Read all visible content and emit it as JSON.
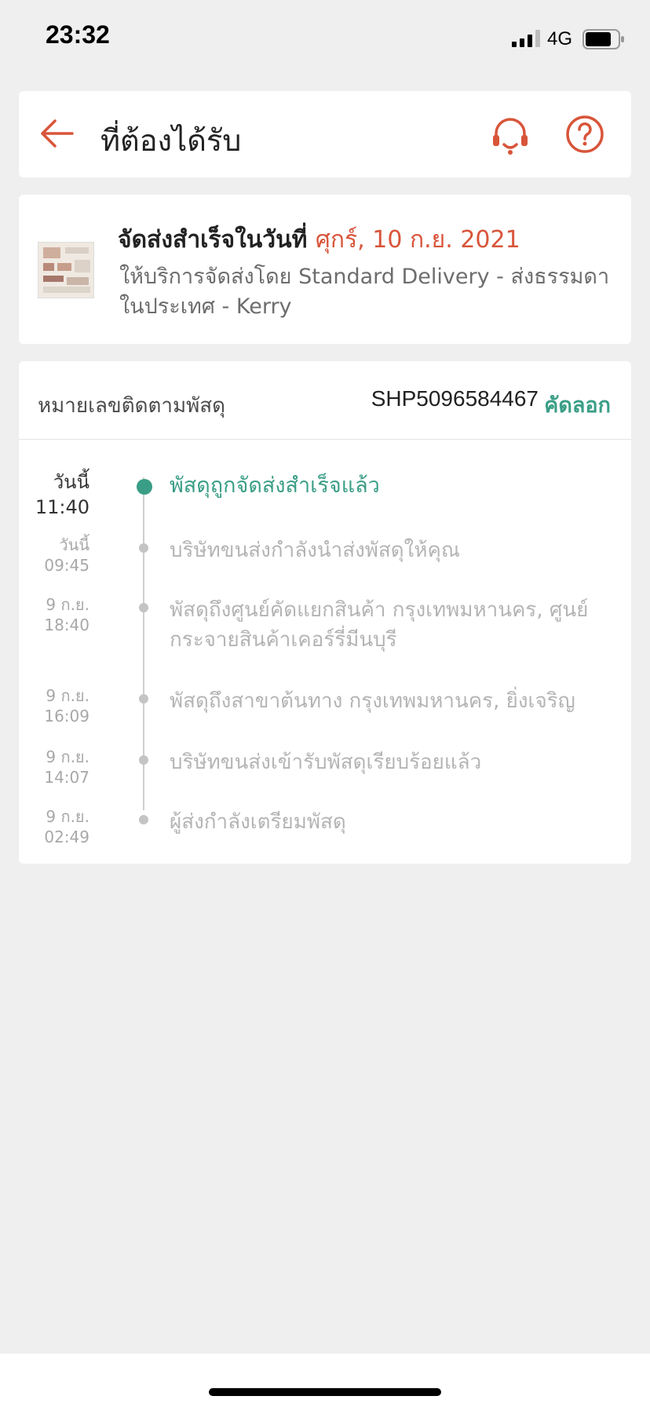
{
  "status_bar": {
    "time": "23:32",
    "network": "4G"
  },
  "header": {
    "title": "ที่ต้องได้รับ",
    "icons": [
      "back-arrow-icon",
      "headset-support-icon",
      "help-icon"
    ],
    "accent_color": "#d8553a"
  },
  "summary": {
    "title_prefix": "จัดส่งสำเร็จในวันที่ ",
    "delivery_date": "ศุกร์, 10 ก.ย. 2021",
    "service_line": "ให้บริการจัดส่งโดย Standard Delivery - ส่งธรรมดาในประเทศ - Kerry"
  },
  "tracking": {
    "label": "หมายเลขติดตามพัสดุ",
    "number": "SHP5096584467",
    "copy_label": "คัดลอก",
    "highlight_color": "#3a9e86"
  },
  "events": [
    {
      "day": "วันนี้",
      "time": "11:40",
      "text": "พัสดุถูกจัดส่งสำเร็จแล้ว"
    },
    {
      "day": "วันนี้",
      "time": "09:45",
      "text": "บริษัทขนส่งกำลังนำส่งพัสดุให้คุณ"
    },
    {
      "day": "9 ก.ย.",
      "time": "18:40",
      "text": "พัสดุถึงศูนย์คัดแยกสินค้า กรุงเทพมหานคร, ศูนย์กระจายสินค้าเคอร์รี่มีนบุรี"
    },
    {
      "day": "9 ก.ย.",
      "time": "16:09",
      "text": "พัสดุถึงสาขาต้นทาง กรุงเทพมหานคร, ยิ่งเจริญ"
    },
    {
      "day": "9 ก.ย.",
      "time": "14:07",
      "text": "บริษัทขนส่งเข้ารับพัสดุเรียบร้อยแล้ว"
    },
    {
      "day": "9 ก.ย.",
      "time": "02:49",
      "text": "ผู้ส่งกำลังเตรียมพัสดุ"
    }
  ]
}
